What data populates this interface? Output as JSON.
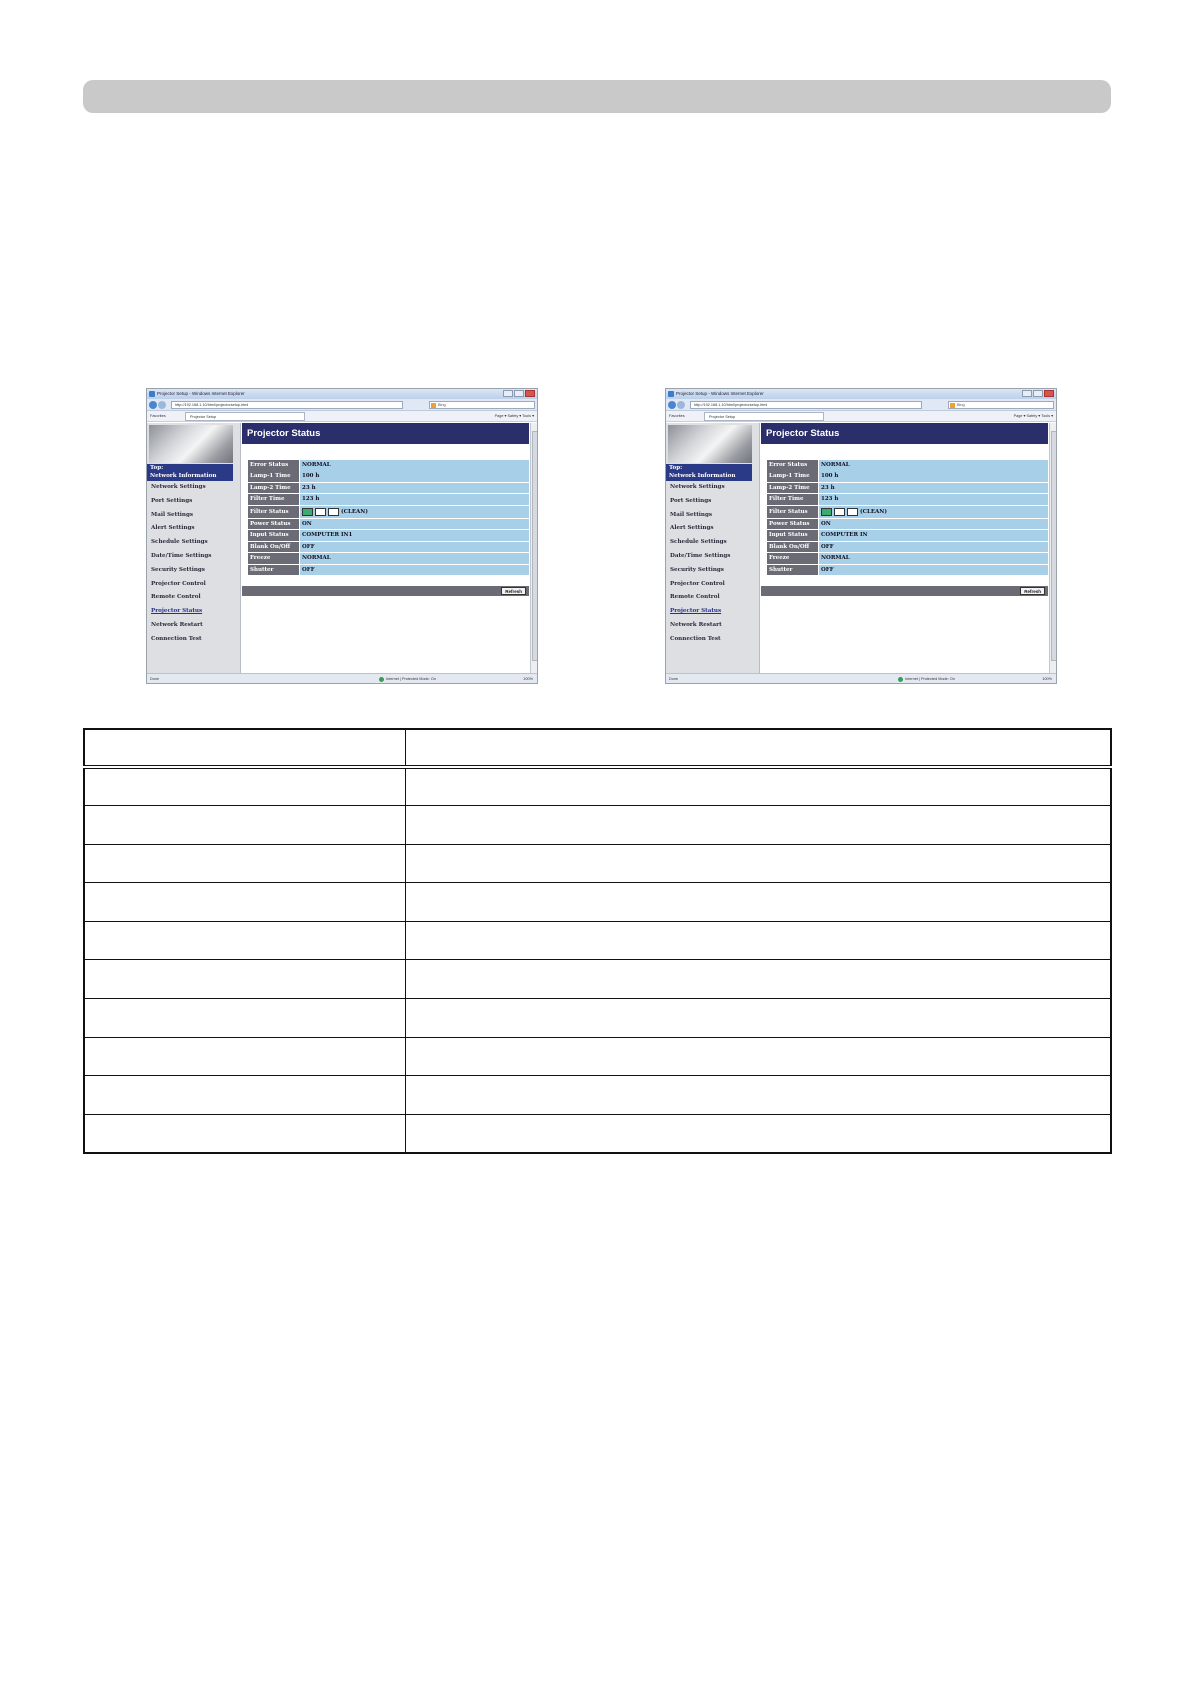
{
  "screenshots": [
    {
      "window_title": "Projector Setup - Windows Internet Explorer",
      "url": "http://192.168.1.10/html/projectorsetup.html",
      "search_engine": "Bing",
      "favorites_label": "Favorites",
      "tab_label": "Projector Setup",
      "toolbar_items": "Page ▾  Safety ▾  Tools ▾",
      "page_heading": "Projector Status",
      "sidebar": {
        "top_line1": "Top:",
        "top_line2": "Network Information",
        "items": [
          "Network Settings",
          "Port Settings",
          "Mail Settings",
          "Alert Settings",
          "Schedule Settings",
          "Date/Time Settings",
          "Security Settings",
          "Projector Control",
          "Remote Control",
          "Projector Status",
          "Network Restart",
          "Connection Test"
        ],
        "active_item": "Projector Status"
      },
      "status_rows": [
        {
          "label": "Error Status",
          "value": "NORMAL"
        },
        {
          "label": "Lamp-1 Time",
          "value": "100 h"
        },
        {
          "label": "Lamp-2 Time",
          "value": "23 h"
        },
        {
          "label": "Filter Time",
          "value": "123 h"
        },
        {
          "label": "Filter Status",
          "value": "(CLEAN)",
          "filter_level": 1,
          "filter_level_max": 3
        },
        {
          "label": "Power Status",
          "value": "ON"
        },
        {
          "label": "Input Status",
          "value": "COMPUTER IN1"
        },
        {
          "label": "Blank On/Off",
          "value": "OFF"
        },
        {
          "label": "Freeze",
          "value": "NORMAL"
        },
        {
          "label": "Shutter",
          "value": "OFF"
        }
      ],
      "refresh_label": "Refresh",
      "status_done": "Done",
      "status_zone": "Internet | Protected Mode: On",
      "status_zoom": "100%"
    },
    {
      "window_title": "Projector Setup - Windows Internet Explorer",
      "url": "http://192.168.1.10/html/projectorsetup.html",
      "search_engine": "Bing",
      "favorites_label": "Favorites",
      "tab_label": "Projector Setup",
      "toolbar_items": "Page ▾  Safety ▾  Tools ▾",
      "page_heading": "Projector Status",
      "sidebar": {
        "top_line1": "Top:",
        "top_line2": "Network Information",
        "items": [
          "Network Settings",
          "Port Settings",
          "Mail Settings",
          "Alert Settings",
          "Schedule Settings",
          "Date/Time Settings",
          "Security Settings",
          "Projector Control",
          "Remote Control",
          "Projector Status",
          "Network Restart",
          "Connection Test"
        ],
        "active_item": "Projector Status"
      },
      "status_rows": [
        {
          "label": "Error Status",
          "value": "NORMAL"
        },
        {
          "label": "Lamp-1 Time",
          "value": "100 h"
        },
        {
          "label": "Lamp-2 Time",
          "value": "23 h"
        },
        {
          "label": "Filter Time",
          "value": "123 h"
        },
        {
          "label": "Filter Status",
          "value": "(CLEAN)",
          "filter_level": 1,
          "filter_level_max": 3
        },
        {
          "label": "Power Status",
          "value": "ON"
        },
        {
          "label": "Input Status",
          "value": "COMPUTER IN"
        },
        {
          "label": "Blank On/Off",
          "value": "OFF"
        },
        {
          "label": "Freeze",
          "value": "NORMAL"
        },
        {
          "label": "Shutter",
          "value": "OFF"
        }
      ],
      "refresh_label": "Refresh",
      "status_done": "Done",
      "status_zone": "Internet | Protected Mode: On",
      "status_zoom": "100%"
    }
  ],
  "table": {
    "rows": 10,
    "columns": 2
  },
  "colors": {
    "header_bar": "#c9c9c9",
    "banner": "#2a2e6a",
    "label_cell": "#6a6b75",
    "value_cell": "#a8cfe8",
    "filter_clean": "#3eaa6e"
  }
}
